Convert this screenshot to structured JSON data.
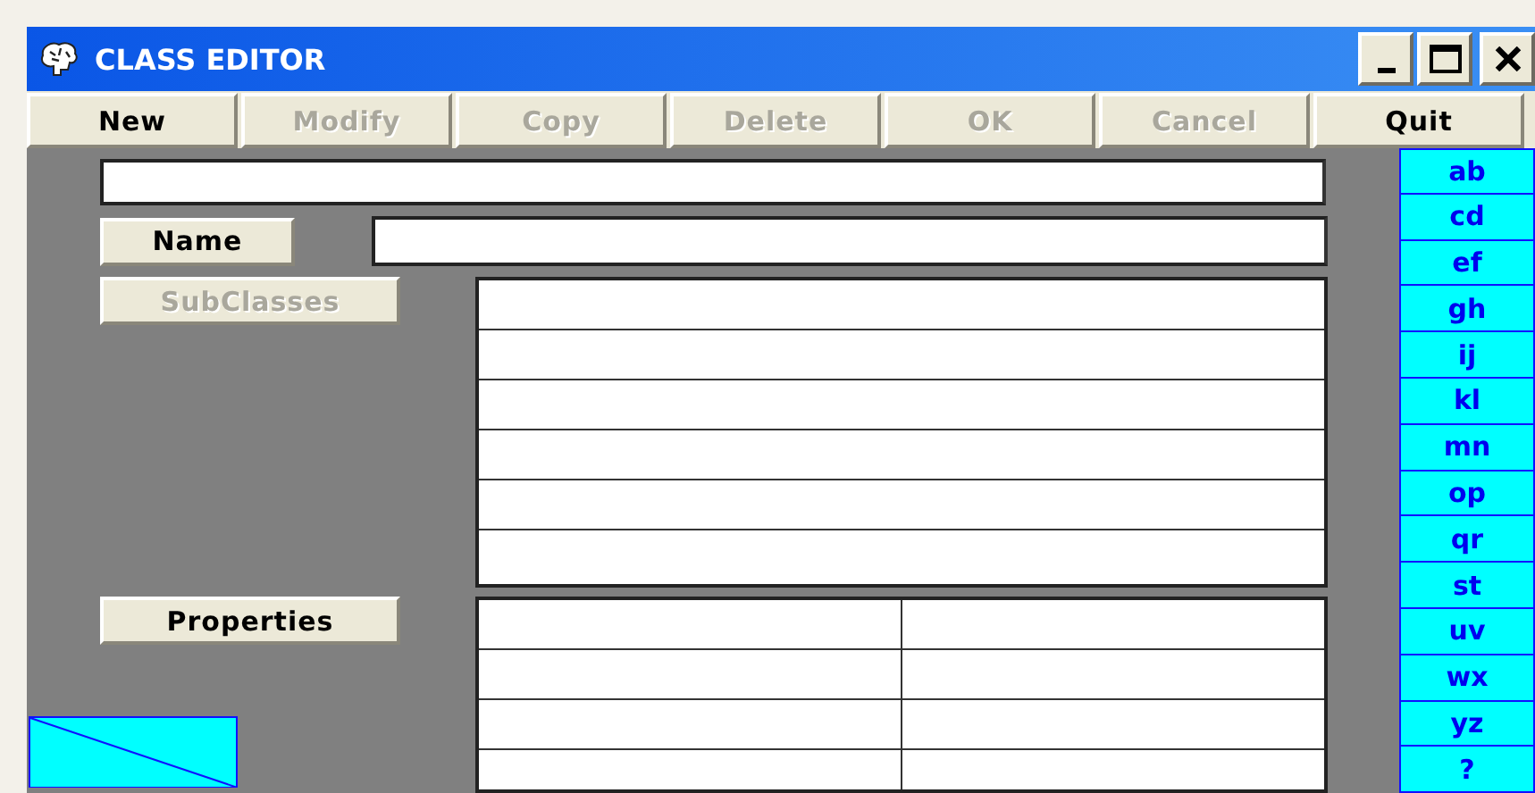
{
  "window": {
    "title": "CLASS EDITOR"
  },
  "toolbar": [
    {
      "label": "New",
      "disabled": false
    },
    {
      "label": "Modify",
      "disabled": true
    },
    {
      "label": "Copy",
      "disabled": true
    },
    {
      "label": "Delete",
      "disabled": true
    },
    {
      "label": "OK",
      "disabled": true
    },
    {
      "label": "Cancel",
      "disabled": true
    },
    {
      "label": "Quit",
      "disabled": false
    }
  ],
  "form": {
    "name_button": {
      "label": "Name",
      "disabled": false
    },
    "subclasses_button": {
      "label": "SubClasses",
      "disabled": true
    },
    "properties_button": {
      "label": "Properties",
      "disabled": false
    }
  },
  "alphabet_index": [
    "ab",
    "cd",
    "ef",
    "gh",
    "ij",
    "kl",
    "mn",
    "op",
    "qr",
    "st",
    "uv",
    "wx",
    "yz",
    "?"
  ]
}
